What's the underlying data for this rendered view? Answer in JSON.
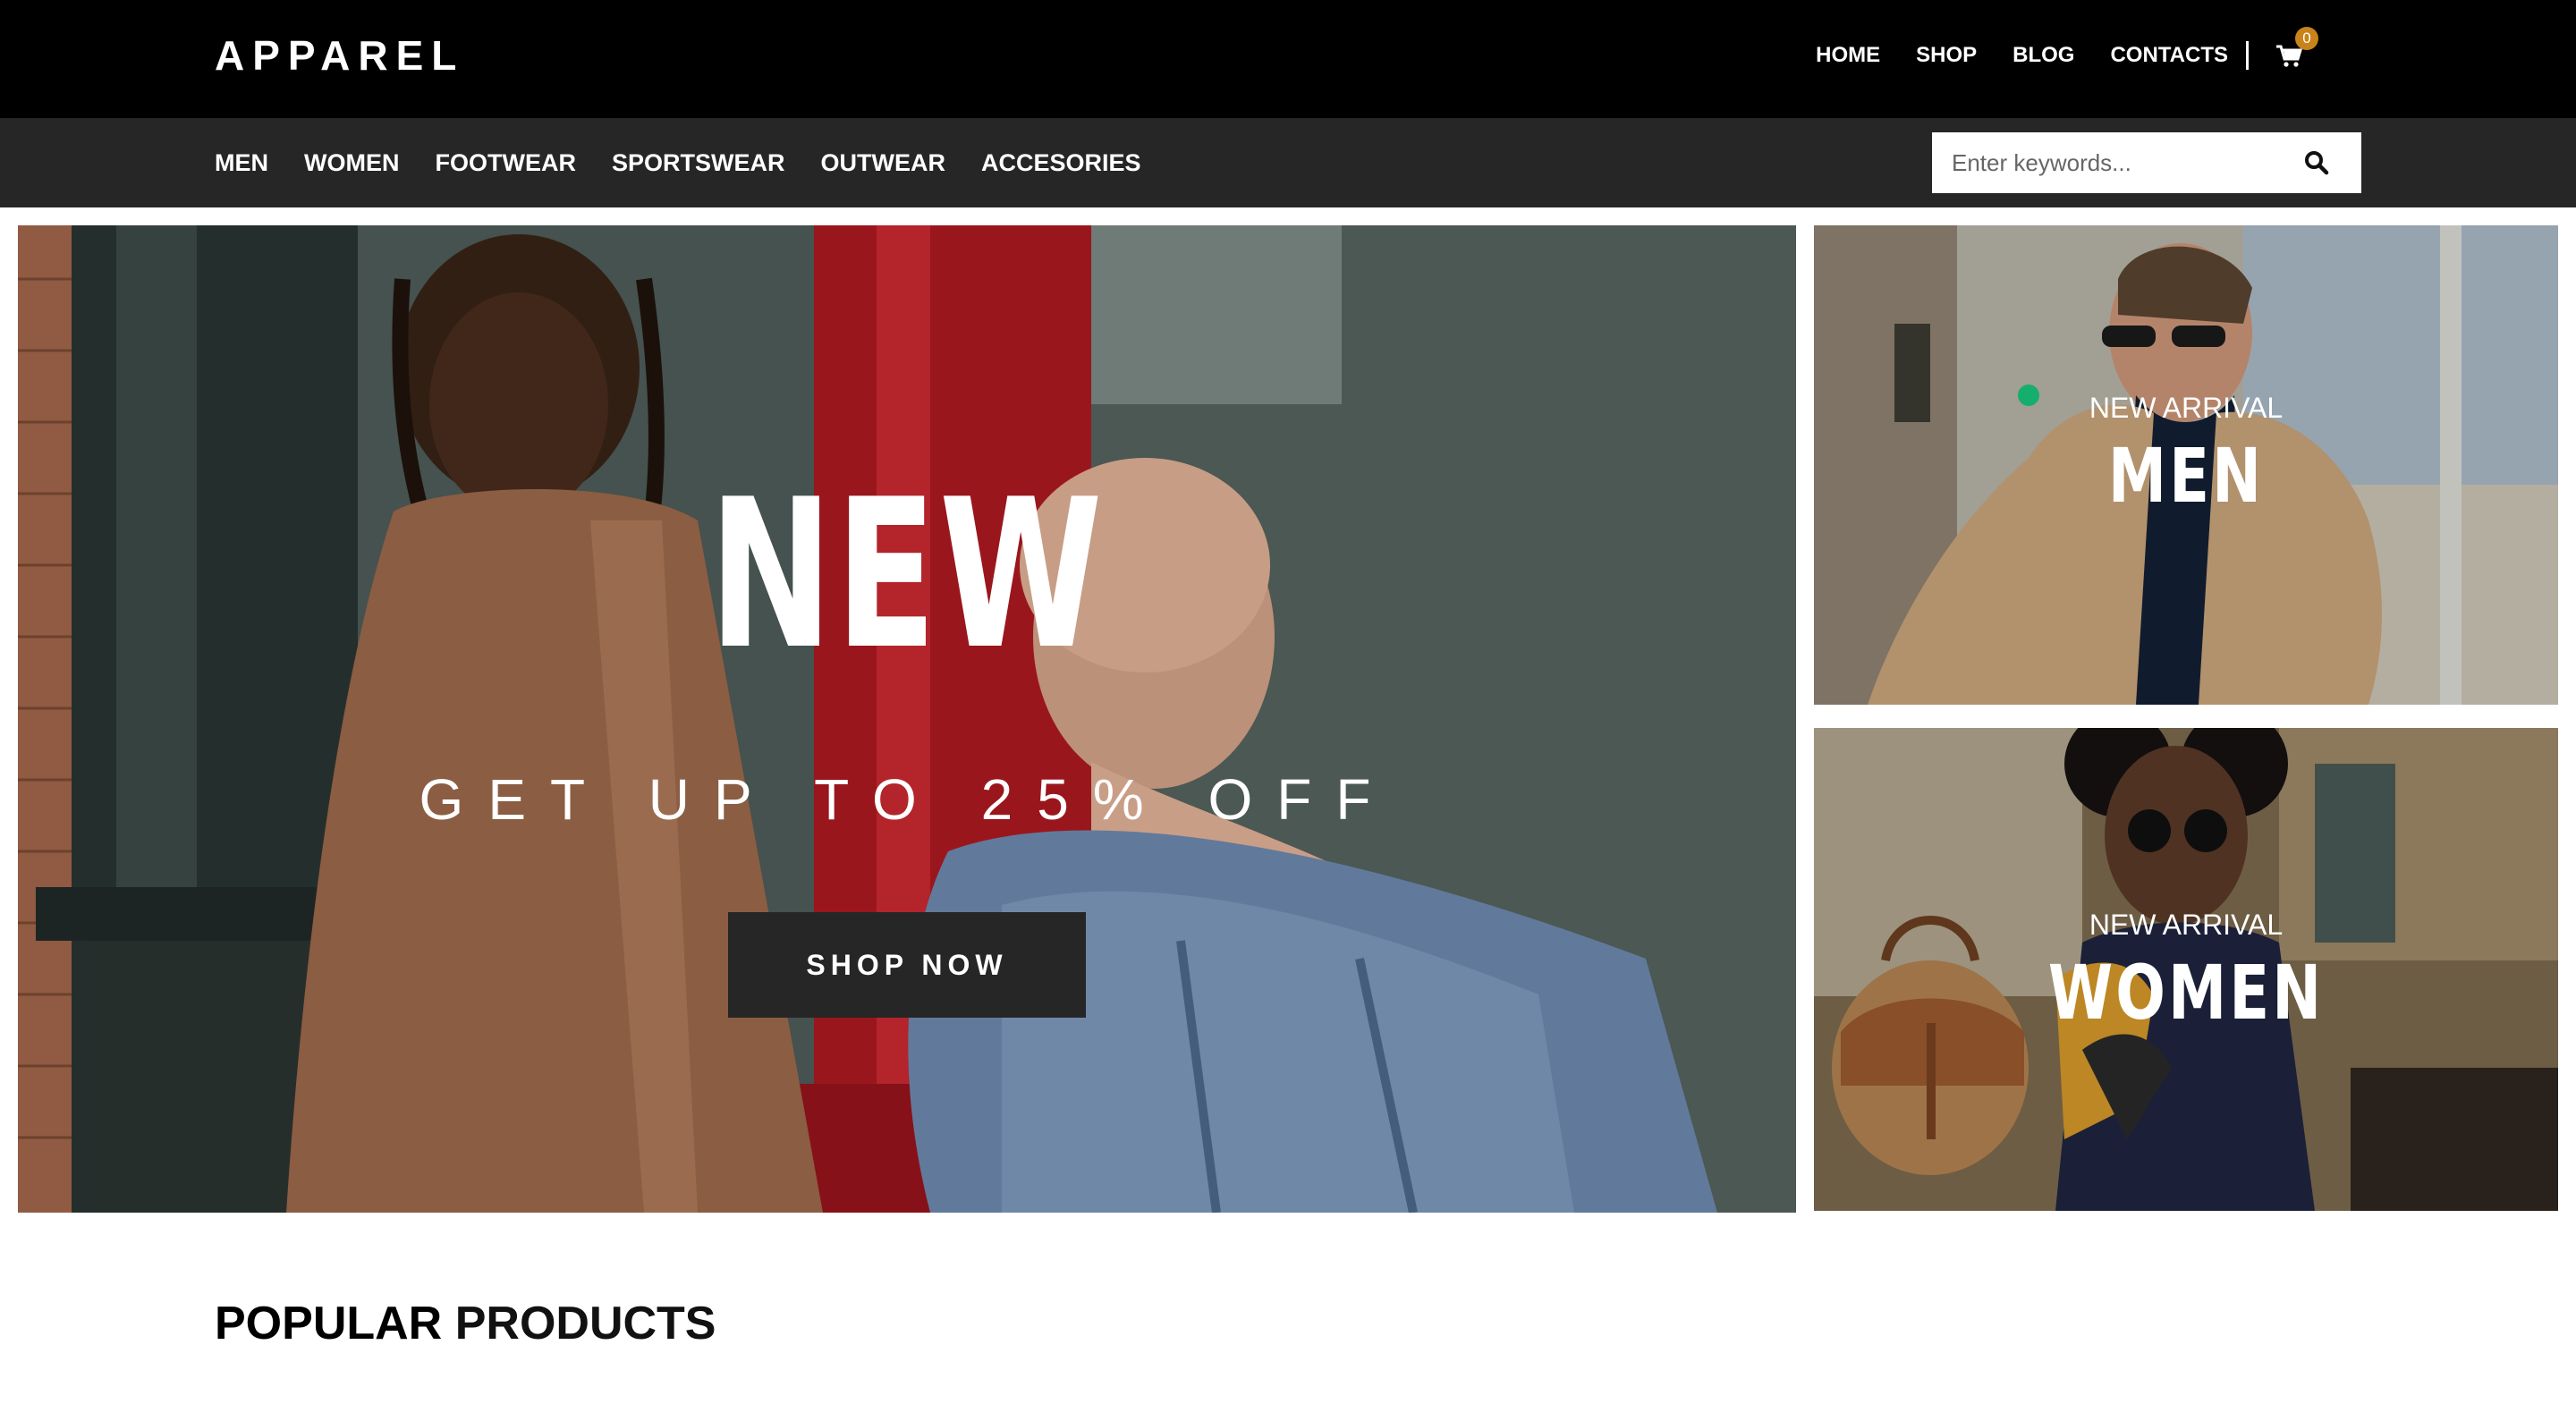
{
  "brand": {
    "logo": "APPAREL"
  },
  "top_nav": {
    "items": [
      {
        "label": "HOME"
      },
      {
        "label": "SHOP"
      },
      {
        "label": "BLOG"
      },
      {
        "label": "CONTACTS"
      }
    ],
    "cart": {
      "icon": "cart-icon",
      "count": "0",
      "badge_color": "#c8831a"
    }
  },
  "category_nav": {
    "items": [
      {
        "label": "MEN"
      },
      {
        "label": "WOMEN"
      },
      {
        "label": "FOOTWEAR"
      },
      {
        "label": "SPORTSWEAR"
      },
      {
        "label": "OUTWEAR"
      },
      {
        "label": "ACCESORIES"
      }
    ]
  },
  "search": {
    "placeholder": "Enter keywords...",
    "value": "",
    "icon": "search-icon"
  },
  "hero": {
    "title": "NEW",
    "subtitle": "GET UP TO 25% OFF",
    "button_label": "SHOP NOW"
  },
  "banners": {
    "men": {
      "kicker": "NEW ARRIVAL",
      "title": "MEN"
    },
    "women": {
      "kicker": "NEW ARRIVAL",
      "title": "WOMEN"
    }
  },
  "popular": {
    "title_strong": "POPULAR",
    "title_rest": "PRODUCTS"
  },
  "colors": {
    "topbar": "#000000",
    "category_bar": "#262626",
    "button": "#262626",
    "accent": "#c8831a"
  }
}
